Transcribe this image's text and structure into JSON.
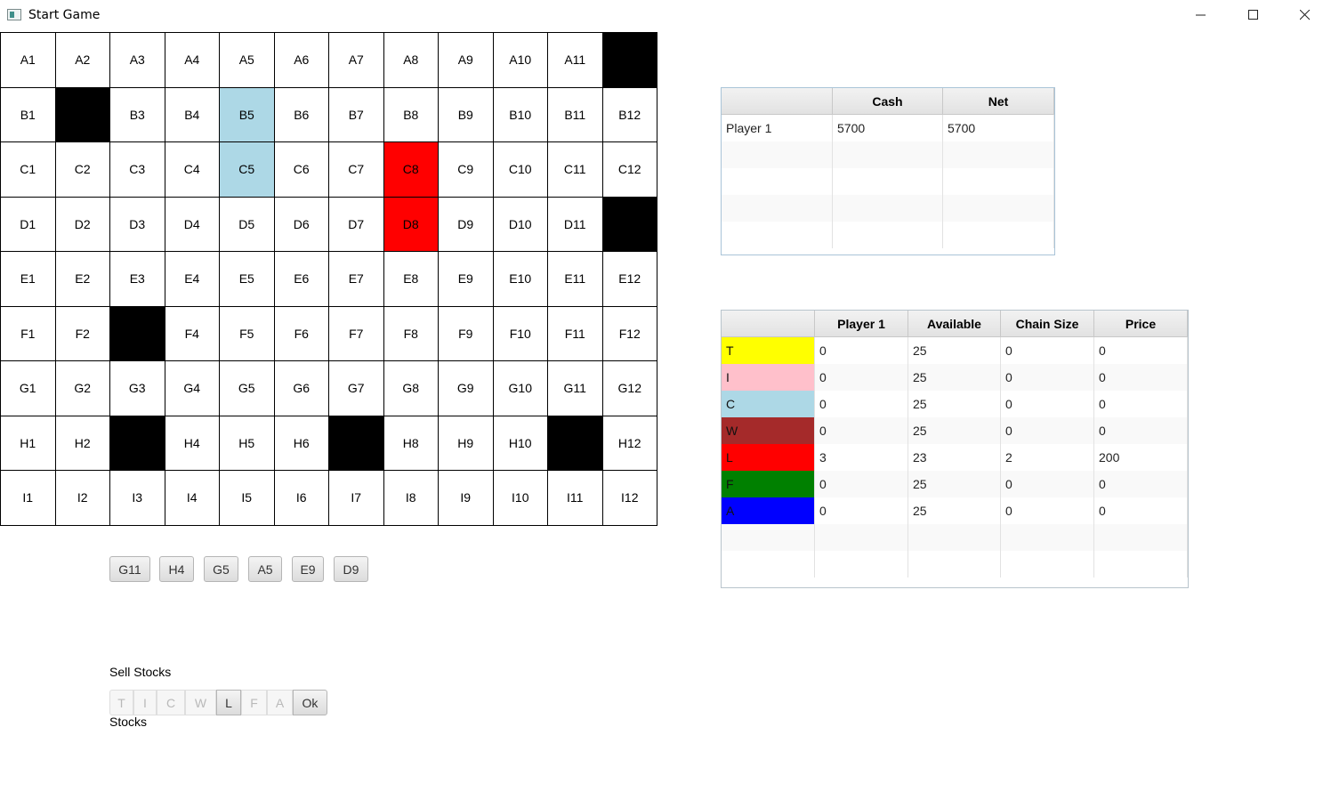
{
  "window": {
    "title": "Start Game",
    "minimize_glyph": "minimize-icon",
    "maximize_glyph": "maximize-icon",
    "close_glyph": "close-icon"
  },
  "board": {
    "rows": [
      [
        "A1",
        "A2",
        "A3",
        "A4",
        "A5",
        "A6",
        "A7",
        "A8",
        "A9",
        "A10",
        "A11",
        ""
      ],
      [
        "B1",
        "",
        "B3",
        "B4",
        "B5",
        "B6",
        "B7",
        "B8",
        "B9",
        "B10",
        "B11",
        "B12"
      ],
      [
        "C1",
        "C2",
        "C3",
        "C4",
        "C5",
        "C6",
        "C7",
        "C8",
        "C9",
        "C10",
        "C11",
        "C12"
      ],
      [
        "D1",
        "D2",
        "D3",
        "D4",
        "D5",
        "D6",
        "D7",
        "D8",
        "D9",
        "D10",
        "D11",
        ""
      ],
      [
        "E1",
        "E2",
        "E3",
        "E4",
        "E5",
        "E6",
        "E7",
        "E8",
        "E9",
        "E10",
        "E11",
        "E12"
      ],
      [
        "F1",
        "F2",
        "",
        "F4",
        "F5",
        "F6",
        "F7",
        "F8",
        "F9",
        "F10",
        "F11",
        "F12"
      ],
      [
        "G1",
        "G2",
        "G3",
        "G4",
        "G5",
        "G6",
        "G7",
        "G8",
        "G9",
        "G10",
        "G11",
        "G12"
      ],
      [
        "H1",
        "H2",
        "",
        "H4",
        "H5",
        "H6",
        "",
        "H8",
        "H9",
        "H10",
        "",
        "H12"
      ],
      [
        "I1",
        "I2",
        "I3",
        "I4",
        "I5",
        "I6",
        "I7",
        "I8",
        "I9",
        "I10",
        "I11",
        "I12"
      ]
    ],
    "cell_states": [
      [
        "",
        "",
        "",
        "",
        "",
        "",
        "",
        "",
        "",
        "",
        "",
        "black"
      ],
      [
        "",
        "black",
        "",
        "",
        "blue",
        "",
        "",
        "",
        "",
        "",
        "",
        ""
      ],
      [
        "",
        "",
        "",
        "",
        "blue",
        "",
        "",
        "red",
        "",
        "",
        "",
        ""
      ],
      [
        "",
        "",
        "",
        "",
        "",
        "",
        "",
        "red",
        "",
        "",
        "",
        "black"
      ],
      [
        "",
        "",
        "",
        "",
        "",
        "",
        "",
        "",
        "",
        "",
        "",
        ""
      ],
      [
        "",
        "",
        "black",
        "",
        "",
        "",
        "",
        "",
        "",
        "",
        "",
        ""
      ],
      [
        "",
        "",
        "",
        "",
        "",
        "",
        "",
        "",
        "",
        "",
        "",
        ""
      ],
      [
        "",
        "",
        "black",
        "",
        "",
        "",
        "black",
        "",
        "",
        "",
        "black",
        ""
      ],
      [
        "",
        "",
        "",
        "",
        "",
        "",
        "",
        "",
        "",
        "",
        "",
        ""
      ]
    ],
    "colors": {
      "black": "#000000",
      "blue": "#add8e6",
      "red": "#ff0000"
    }
  },
  "hand_tiles": [
    "G11",
    "H4",
    "G5",
    "A5",
    "E9",
    "D9"
  ],
  "sell": {
    "label": "Sell Stocks",
    "buttons": [
      {
        "label": "T",
        "enabled": false
      },
      {
        "label": "I",
        "enabled": false
      },
      {
        "label": "C",
        "enabled": false
      },
      {
        "label": "W",
        "enabled": false
      },
      {
        "label": "L",
        "enabled": true
      },
      {
        "label": "F",
        "enabled": false
      },
      {
        "label": "A",
        "enabled": false
      }
    ],
    "ok_label": "Ok",
    "stocks_label": "Stocks"
  },
  "player_table": {
    "columns": [
      "",
      "Cash",
      "Net"
    ],
    "rows": [
      [
        "Player 1",
        "5700",
        "5700"
      ],
      [
        "",
        "",
        ""
      ],
      [
        "",
        "",
        ""
      ],
      [
        "",
        "",
        ""
      ],
      [
        "",
        "",
        ""
      ]
    ]
  },
  "chain_table": {
    "columns": [
      "",
      "Player 1",
      "Available",
      "Chain Size",
      "Price"
    ],
    "rows": [
      {
        "name": "T",
        "color": "#ffff00",
        "values": [
          "0",
          "25",
          "0",
          "0"
        ]
      },
      {
        "name": "I",
        "color": "#ffc0cb",
        "values": [
          "0",
          "25",
          "0",
          "0"
        ]
      },
      {
        "name": "C",
        "color": "#add8e6",
        "values": [
          "0",
          "25",
          "0",
          "0"
        ]
      },
      {
        "name": "W",
        "color": "#a52a2a",
        "values": [
          "0",
          "25",
          "0",
          "0"
        ]
      },
      {
        "name": "L",
        "color": "#ff0000",
        "values": [
          "3",
          "23",
          "2",
          "200"
        ]
      },
      {
        "name": "F",
        "color": "#008000",
        "values": [
          "0",
          "25",
          "0",
          "0"
        ]
      },
      {
        "name": "A",
        "color": "#0000ff",
        "values": [
          "0",
          "25",
          "0",
          "0"
        ]
      },
      {
        "name": "",
        "color": "",
        "values": [
          "",
          "",
          "",
          ""
        ]
      },
      {
        "name": "",
        "color": "",
        "values": [
          "",
          "",
          "",
          ""
        ]
      }
    ]
  }
}
